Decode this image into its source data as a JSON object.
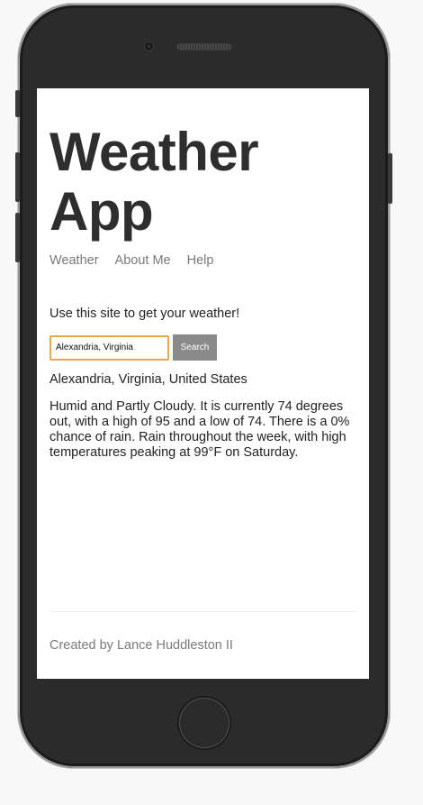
{
  "app": {
    "title": "Weather App"
  },
  "nav": {
    "items": [
      "Weather",
      "About Me",
      "Help"
    ]
  },
  "intro": "Use this site to get your weather!",
  "search": {
    "value": "Alexandria, Virginia",
    "button_label": "Search"
  },
  "result": {
    "location": "Alexandria, Virginia, United States",
    "forecast": "Humid and Partly Cloudy. It is currently 74 degrees out, with a high of 95 and a low of 74. There is a 0% chance of rain. Rain throughout the week, with high temperatures peaking at 99°F on Saturday."
  },
  "footer": {
    "text": "Created by Lance Huddleston II"
  },
  "colors": {
    "input_focus_border": "#e8a94a",
    "button_bg": "#8a8a8a",
    "phone_body": "#2b2b2b"
  }
}
